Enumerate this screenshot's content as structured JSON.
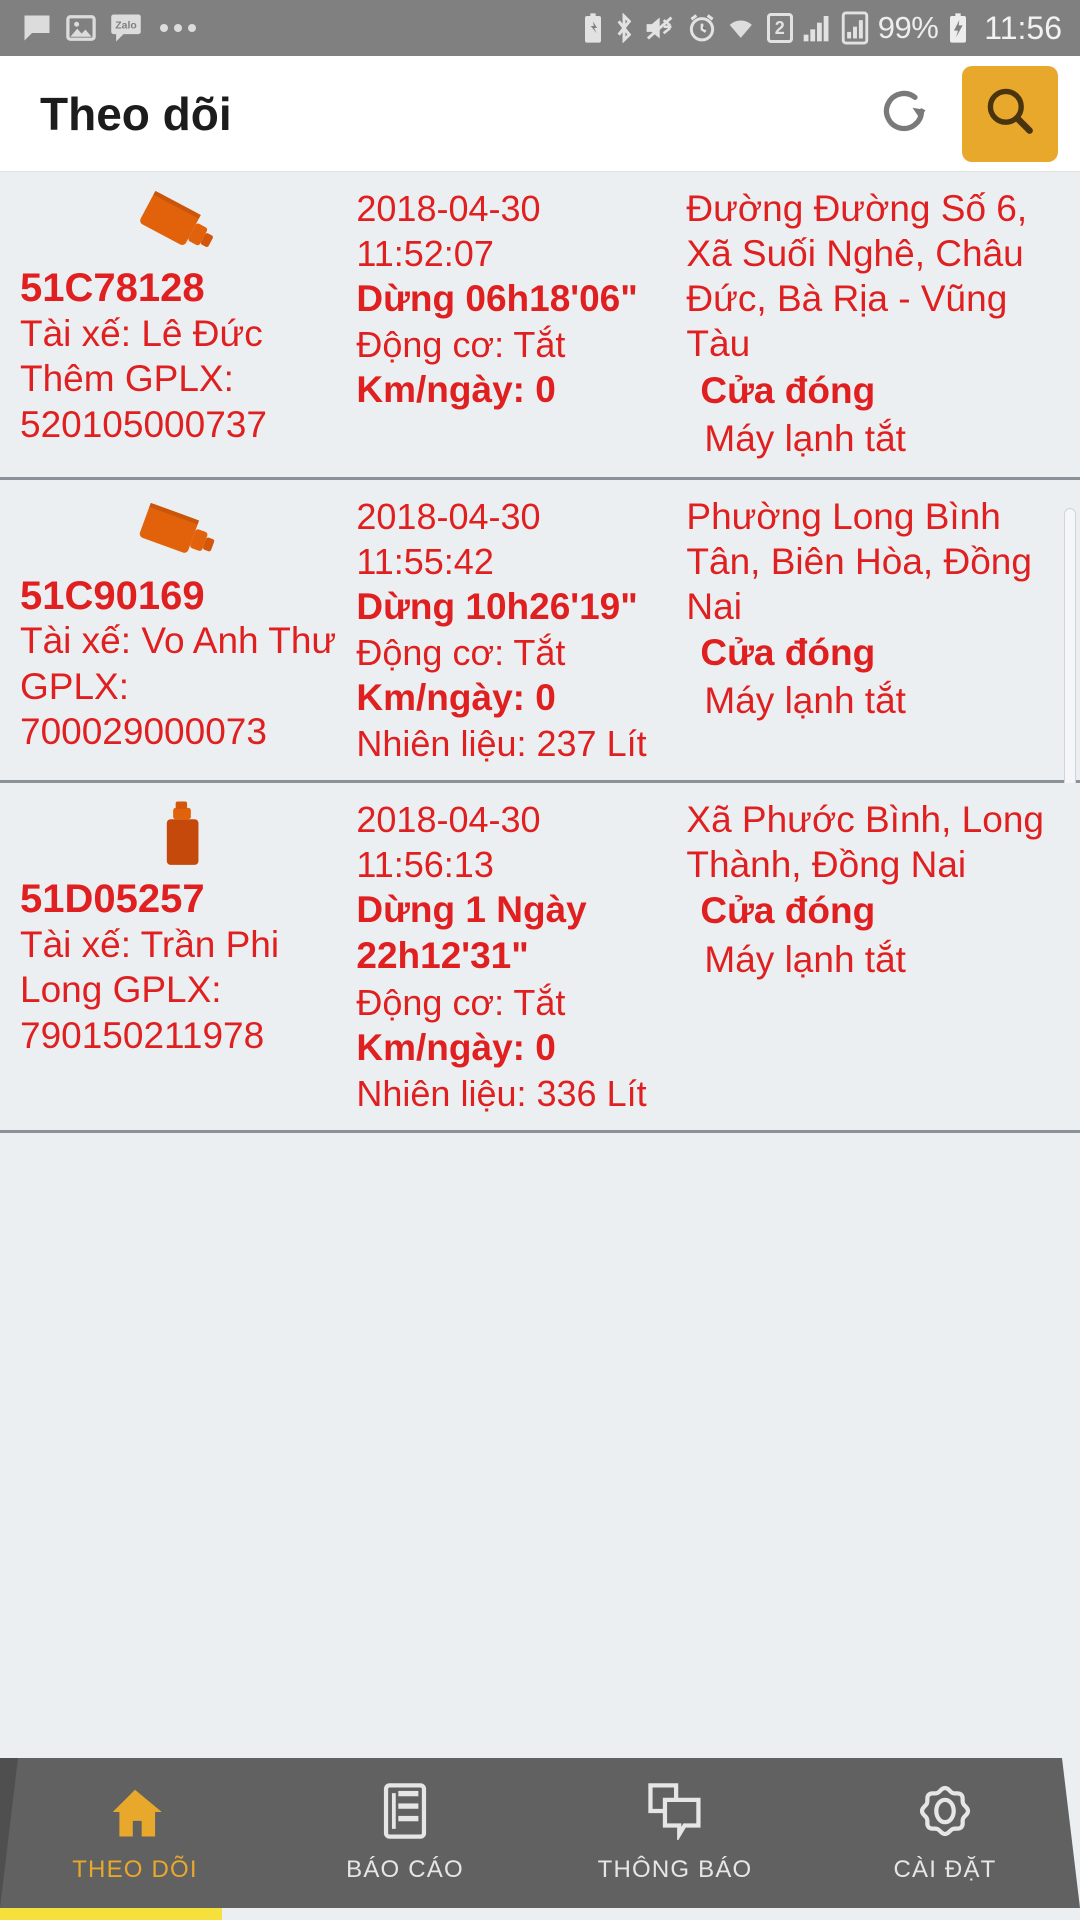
{
  "statusbar": {
    "left_icons": [
      "message-icon",
      "photo-icon",
      "zalo-icon",
      "overflow-dots-icon"
    ],
    "zalo_label": "Zalo",
    "right_icons": [
      "battery-saver-icon",
      "bluetooth-icon",
      "vibrate-icon",
      "alarm-icon",
      "wifi-icon",
      "sim-icon",
      "signal-1-icon",
      "signal-2-icon"
    ],
    "sim_slot": "2",
    "battery_percent": "99%",
    "time": "11:56"
  },
  "appbar": {
    "title": "Theo dõi",
    "refresh_icon": "refresh-icon",
    "search_icon": "search-icon",
    "search_button_color": "#e8a82c"
  },
  "colors": {
    "text_red": "#e02020",
    "accent_amber": "#e8a82c",
    "nav_bg": "#616161",
    "list_bg": "#eceff1",
    "divider": "#8a9199",
    "indicator_yellow": "#f5e03c"
  },
  "list": {
    "rows": [
      {
        "icon": "truck-icon",
        "icon_rotation": "diagonal",
        "plate": "51C78128",
        "driver": "Tài xế: Lê Đức Thêm GPLX: 520105000737",
        "timestamp": "2018-04-30 11:52:07",
        "stop_status": "Dừng  06h18'06\"",
        "engine": "Động cơ: Tắt",
        "km_per_day": "Km/ngày: 0",
        "fuel": "",
        "address": "Đường Đường  Số 6, Xã Suối Nghê, Châu Đức, Bà Rịa - Vũng Tàu",
        "door": "Cửa đóng",
        "ac": "Máy lạnh tắt"
      },
      {
        "icon": "truck-icon",
        "icon_rotation": "diagonal",
        "plate": "51C90169",
        "driver": "Tài xế: Vo Anh Thư GPLX: 700029000073",
        "timestamp": "2018-04-30 11:55:42",
        "stop_status": "Dừng  10h26'19\"",
        "engine": "Động cơ: Tắt",
        "km_per_day": "Km/ngày: 0",
        "fuel": "Nhiên liệu: 237 Lít",
        "address": "Phường Long Bình Tân, Biên Hòa, Đồng Nai",
        "door": "Cửa đóng",
        "ac": "Máy lạnh tắt"
      },
      {
        "icon": "truck-icon",
        "icon_rotation": "up",
        "plate": "51D05257",
        "driver": "Tài xế: Trần Phi Long GPLX: 790150211978",
        "timestamp": "2018-04-30 11:56:13",
        "stop_status": "Dừng 1 Ngày 22h12'31\"",
        "engine": "Động cơ: Tắt",
        "km_per_day": "Km/ngày: 0",
        "fuel": "Nhiên liệu: 336 Lít",
        "address": "Xã Phước Bình, Long Thành, Đồng Nai",
        "door": "Cửa đóng",
        "ac": "Máy lạnh tắt"
      }
    ]
  },
  "bottom_nav": {
    "items": [
      {
        "label": "THEO DÕI",
        "icon": "home-icon",
        "active": true
      },
      {
        "label": "BÁO CÁO",
        "icon": "report-document-icon",
        "active": false
      },
      {
        "label": "THÔNG BÁO",
        "icon": "chat-bubbles-icon",
        "active": false
      },
      {
        "label": "CÀI ĐẶT",
        "icon": "gear-icon",
        "active": false
      }
    ]
  }
}
